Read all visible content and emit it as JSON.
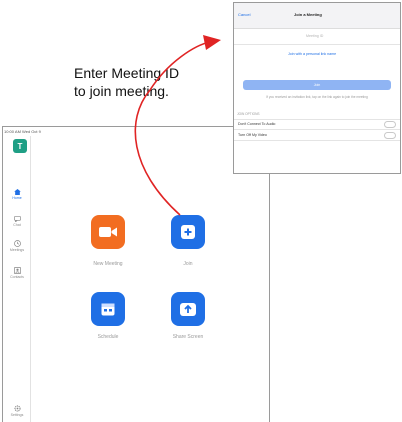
{
  "callout": {
    "line1": "Enter Meeting ID",
    "line2": "to join meeting."
  },
  "status_bar": {
    "text": "10:00 AM   Wed Oct 9"
  },
  "avatar": {
    "initial": "T"
  },
  "sidebar": {
    "items": [
      {
        "label": "Home",
        "icon": "home-icon"
      },
      {
        "label": "Chat",
        "icon": "chat-icon"
      },
      {
        "label": "Meetings",
        "icon": "clock-icon"
      },
      {
        "label": "Contacts",
        "icon": "contacts-icon"
      },
      {
        "label": "Settings",
        "icon": "gear-icon"
      }
    ]
  },
  "tiles": {
    "new_meeting": {
      "label": "New Meeting",
      "color": "#f26d21",
      "icon": "video-camera-icon"
    },
    "join": {
      "label": "Join",
      "color": "#1f6fe5",
      "icon": "plus-icon"
    },
    "schedule": {
      "label": "Schedule",
      "color": "#1f6fe5",
      "icon": "calendar-icon"
    },
    "share_screen": {
      "label": "Share Screen",
      "color": "#1f6fe5",
      "icon": "share-screen-icon"
    }
  },
  "join_panel": {
    "cancel_label": "Cancel",
    "title": "Join a Meeting",
    "meeting_id_placeholder": "Meeting ID",
    "personal_link_label": "Join with a personal link name",
    "join_button_label": "Join",
    "invitation_note": "If you received an invitation link, tap on the link again to join the meeting",
    "options_header": "JOIN OPTIONS",
    "options": [
      {
        "label": "Don't Connect To Audio",
        "on": false
      },
      {
        "label": "Turn Off My Video",
        "on": false
      }
    ]
  },
  "colors": {
    "accent_blue": "#1f6fe5",
    "orange": "#f26d21",
    "arrow_red": "#e02424",
    "avatar_green": "#1f9f85"
  }
}
